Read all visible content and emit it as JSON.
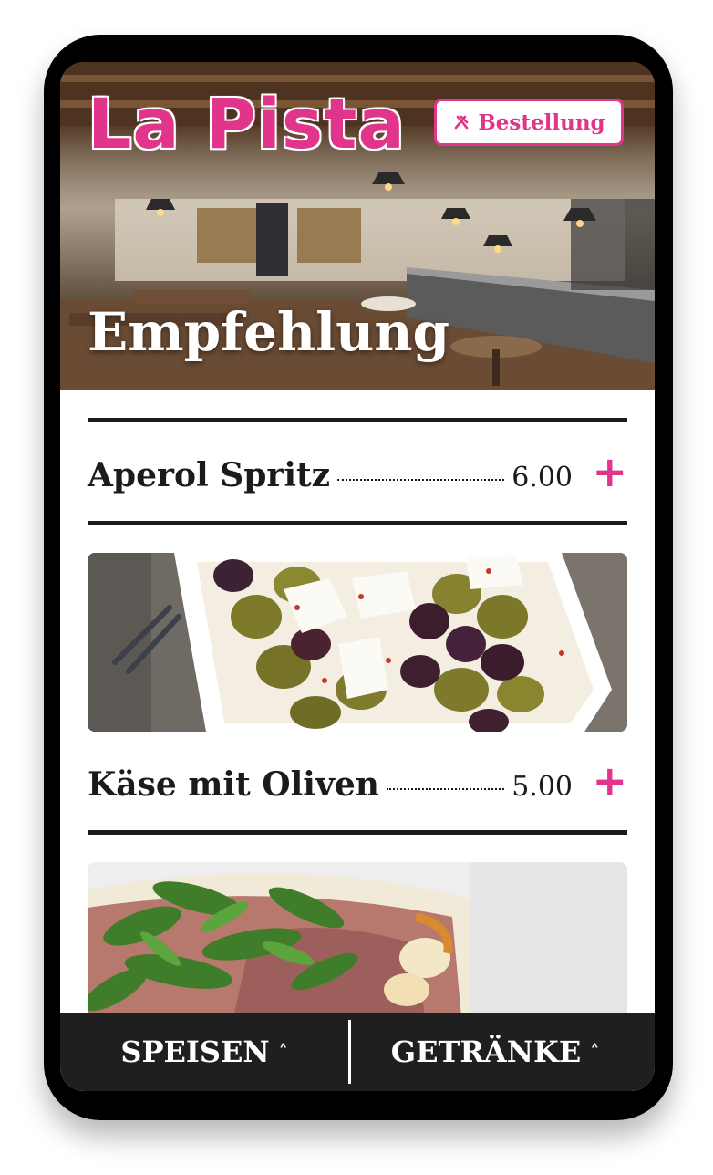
{
  "header": {
    "brand": "La Pista",
    "order_button_label": "Bestellung",
    "section_title": "Empfehlung"
  },
  "items": [
    {
      "name": "Aperol Spritz",
      "price": "6.00",
      "add_label": "+"
    },
    {
      "name": "Käse mit Oliven",
      "price": "5.00",
      "add_label": "+"
    }
  ],
  "bottom_nav": {
    "tabs": [
      {
        "label": "SPEISEN",
        "chevron": "˄"
      },
      {
        "label": "GETRÄNKE",
        "chevron": "˄"
      }
    ]
  },
  "colors": {
    "accent": "#e0358a",
    "text": "#1b1b1b",
    "nav_bg": "#1f1f1f"
  },
  "icons": {
    "order": "fork-knife-icon",
    "add": "plus-icon",
    "chevron": "chevron-up-icon"
  }
}
